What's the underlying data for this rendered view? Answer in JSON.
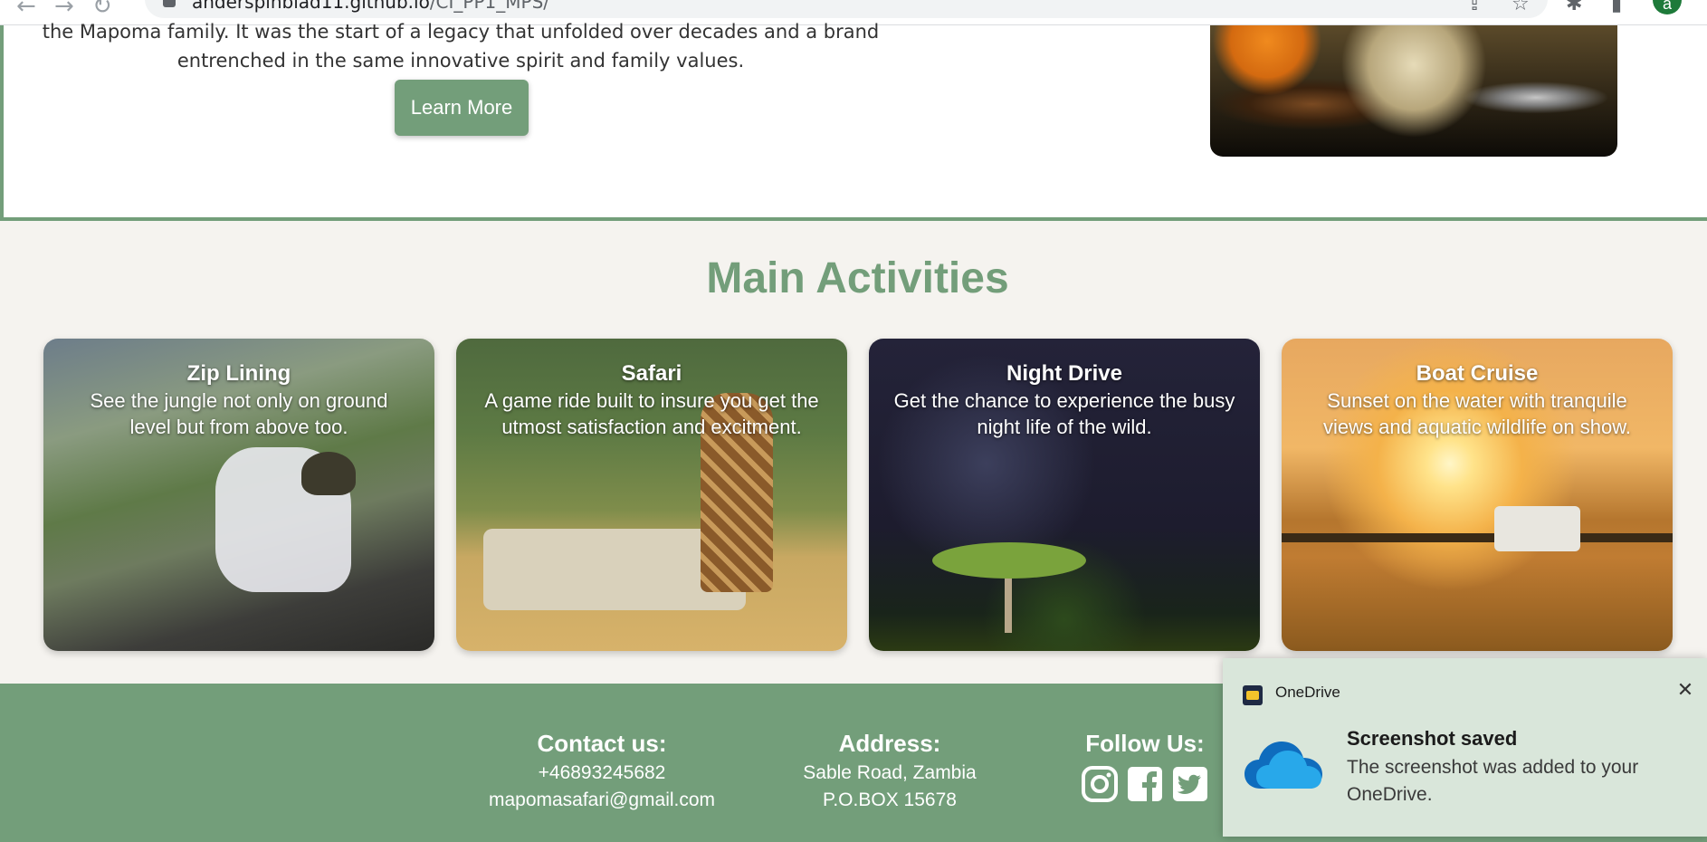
{
  "browser": {
    "url_host": "anderspinblad11.github.io",
    "url_path": "/CI_PP1_MPS/",
    "profile_initial": "a"
  },
  "about": {
    "text_line1": "the Mapoma family. It was the start of a legacy that unfolded over decades and a brand",
    "text_line2": "entrenched in the same innovative spirit and family values.",
    "button_label": "Learn More"
  },
  "activities": {
    "title": "Main Activities",
    "cards": [
      {
        "title": "Zip Lining",
        "description": "See the jungle not only on ground level but from above too."
      },
      {
        "title": "Safari",
        "description": "A game ride built to insure you get the utmost satisfaction and excitment."
      },
      {
        "title": "Night Drive",
        "description": "Get the chance to experience the busy night life of the wild."
      },
      {
        "title": "Boat Cruise",
        "description": "Sunset on the water with tranquile views and aquatic wildlife on show."
      }
    ]
  },
  "footer": {
    "contact": {
      "heading": "Contact us:",
      "phone": "+46893245682",
      "email": "mapomasafari@gmail.com"
    },
    "address": {
      "heading": "Address:",
      "line1": "Sable Road, Zambia",
      "line2": "P.O.BOX 15678"
    },
    "follow": {
      "heading": "Follow Us:",
      "icons": [
        "instagram-icon",
        "facebook-icon",
        "twitter-icon"
      ]
    }
  },
  "toast": {
    "app_name": "OneDrive",
    "title": "Screenshot saved",
    "body": "The screenshot was added to your OneDrive."
  },
  "colors": {
    "accent_green": "#739e7a",
    "section_bg": "#f5f3ef",
    "toast_bg": "#d9e6da"
  }
}
